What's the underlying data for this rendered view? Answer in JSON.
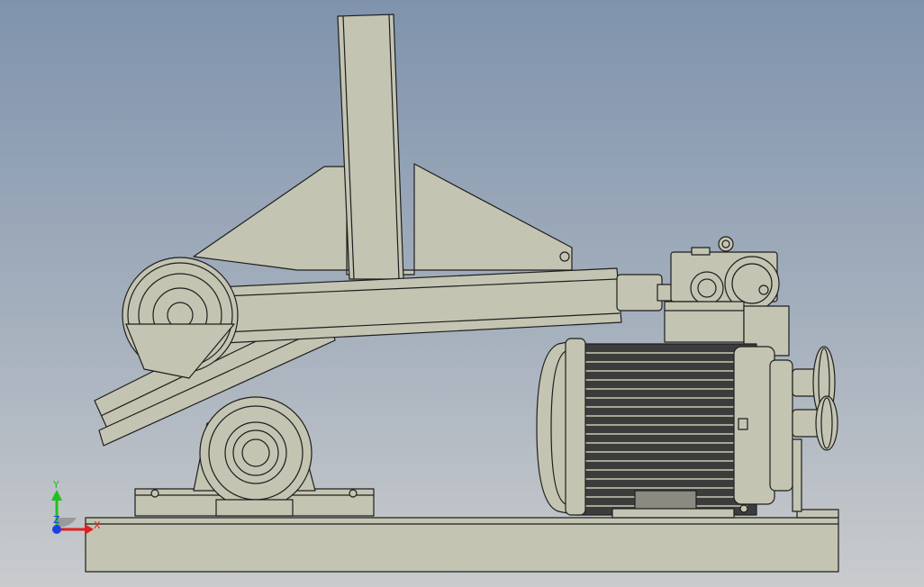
{
  "viewport": {
    "background_top": "#7f93ad",
    "background_bottom": "#c9cbcd"
  },
  "model": {
    "part_color": "#c4c4b2",
    "part_shadow": "#a6a696",
    "edge_color": "#1e1e1e",
    "motor_dark": "#3c3c3c"
  },
  "triad": {
    "x_label": "X",
    "y_label": "Y",
    "z_label": "Z",
    "x_color": "#e02020",
    "y_color": "#20c020",
    "z_color": "#2040e0"
  }
}
